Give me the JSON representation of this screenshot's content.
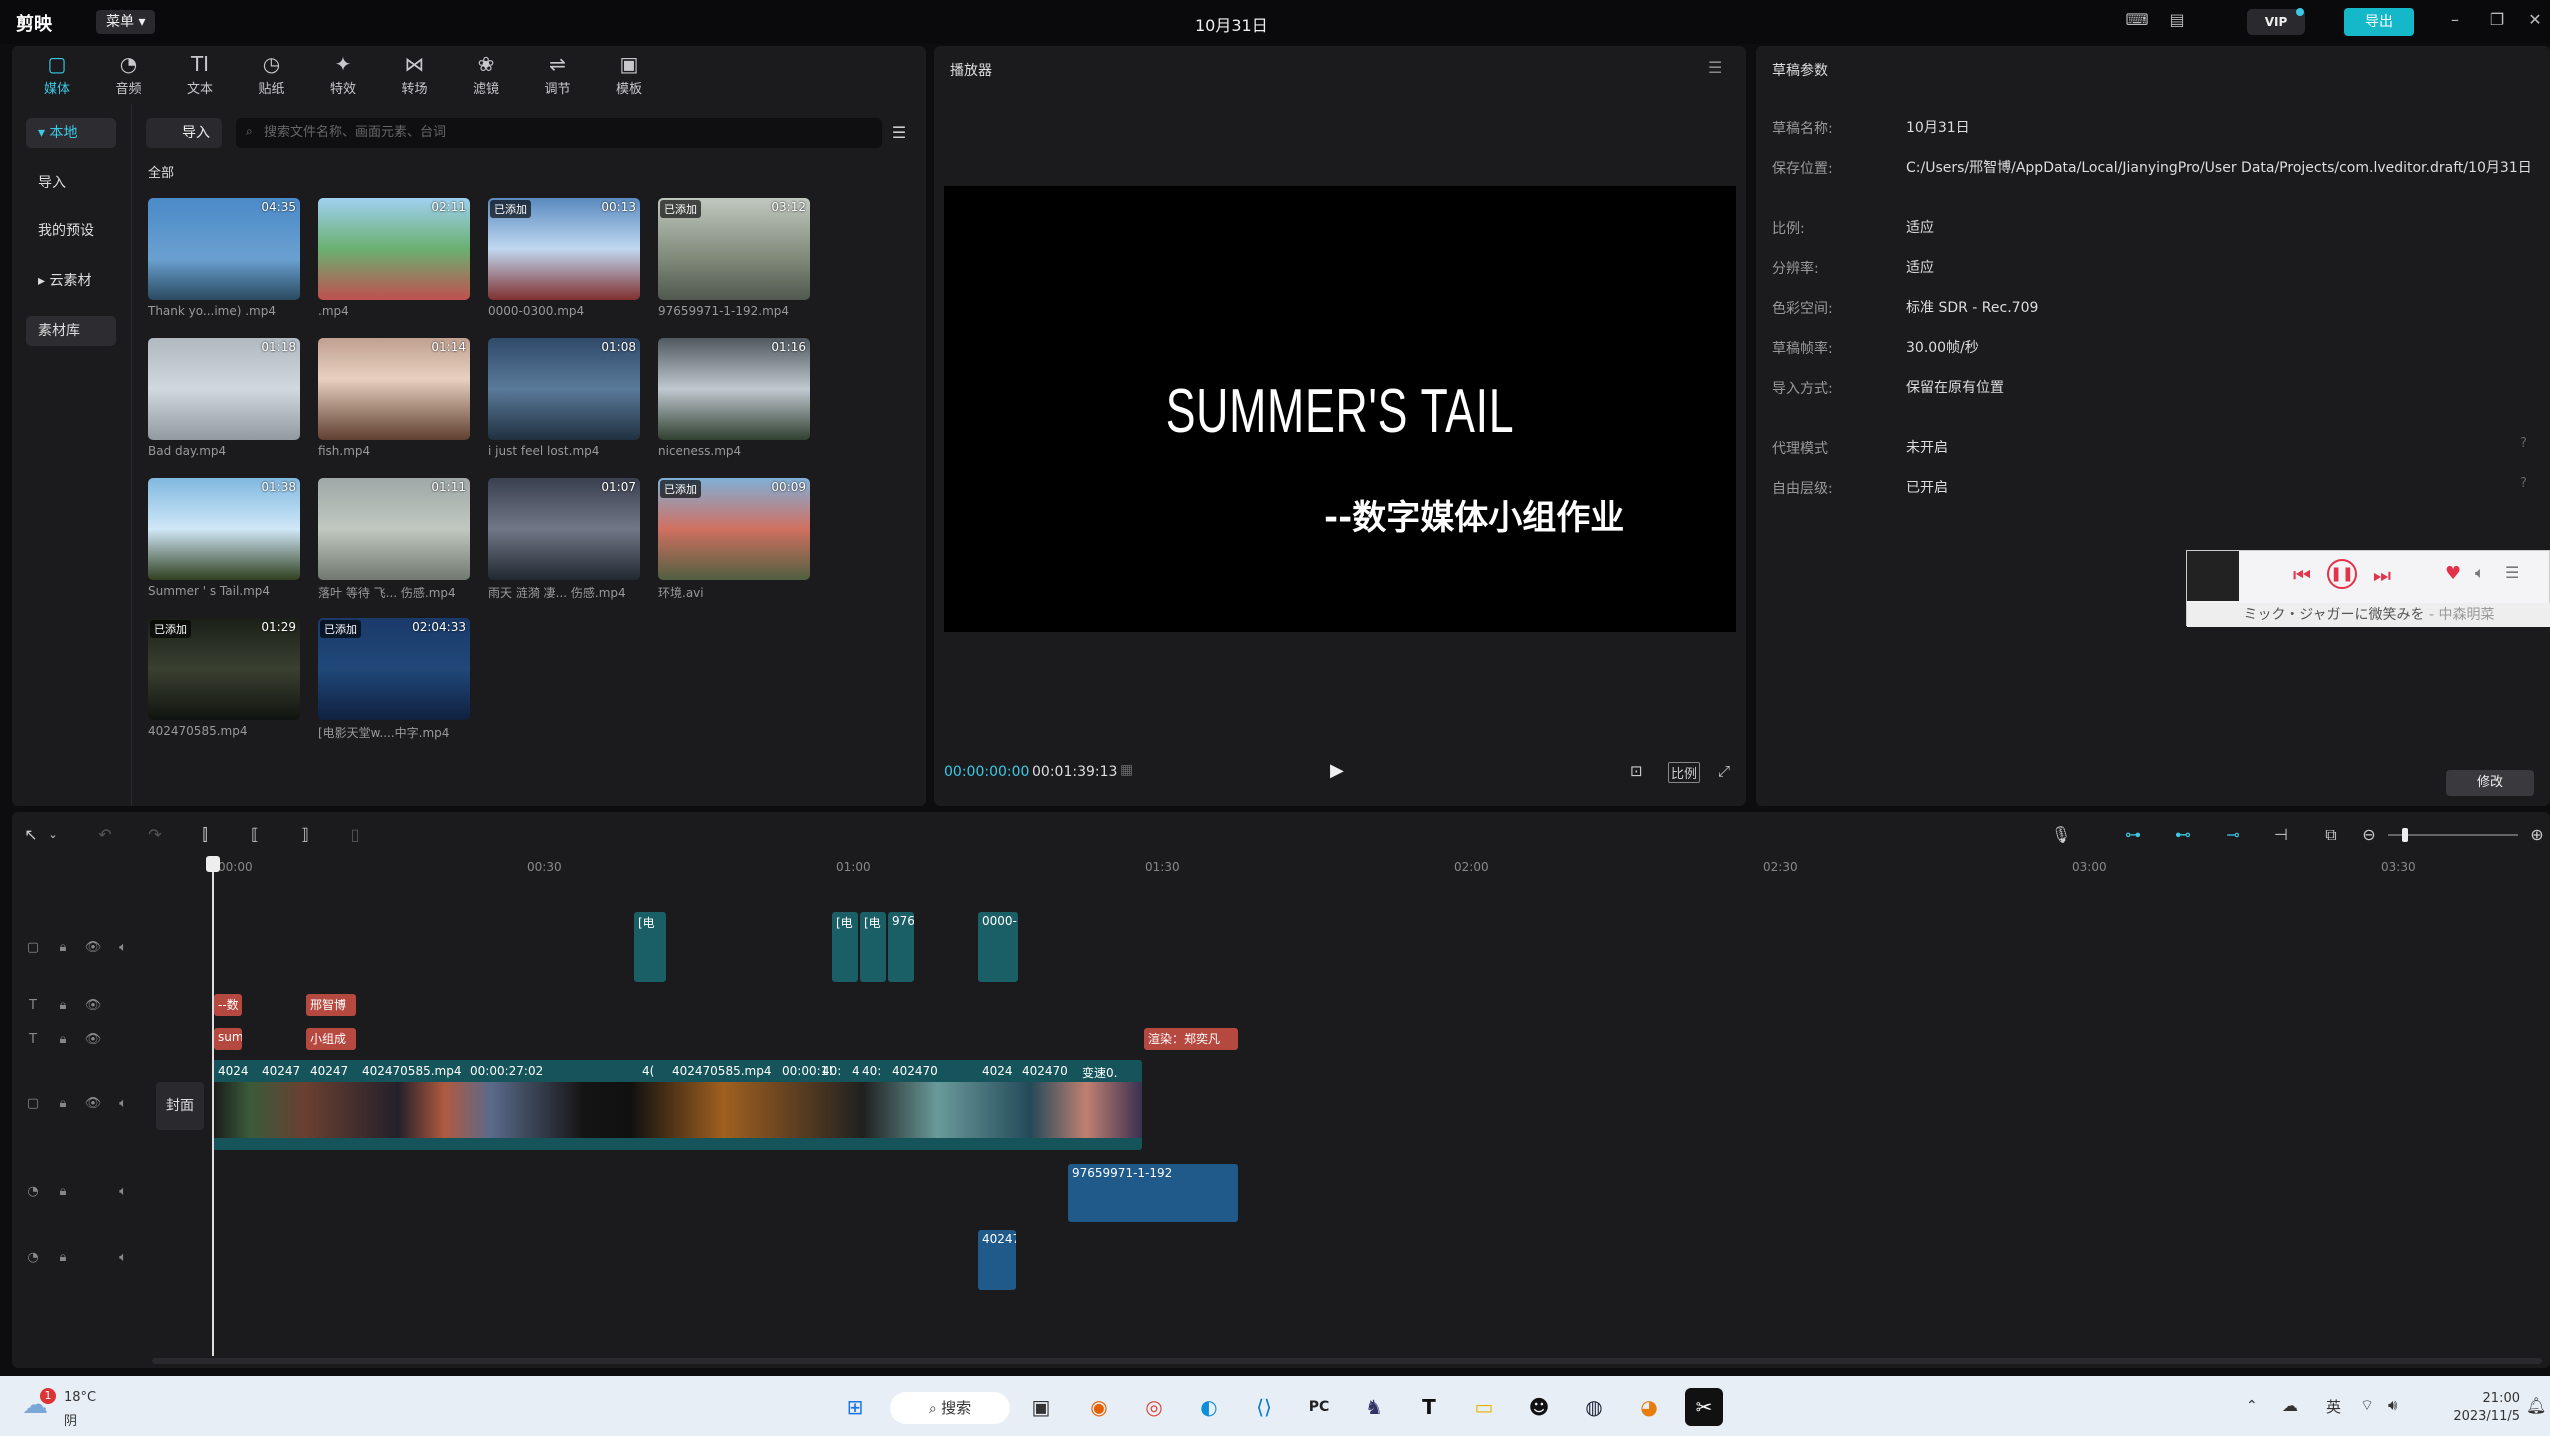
{
  "titlebar": {
    "logo": "剪映",
    "menu": "菜单 ▾",
    "title": "10月31日",
    "vip": "VIP",
    "export": "导出"
  },
  "categories": [
    {
      "label": "媒体",
      "icon": "▢"
    },
    {
      "label": "音频",
      "icon": "◔"
    },
    {
      "label": "文本",
      "icon": "TI"
    },
    {
      "label": "贴纸",
      "icon": "◷"
    },
    {
      "label": "特效",
      "icon": "✦"
    },
    {
      "label": "转场",
      "icon": "⋈"
    },
    {
      "label": "滤镜",
      "icon": "❀"
    },
    {
      "label": "调节",
      "icon": "⇌"
    },
    {
      "label": "模板",
      "icon": "▣"
    }
  ],
  "nav": [
    "▾ 本地",
    "导入",
    "我的预设",
    "▸ 云素材",
    "素材库"
  ],
  "media": {
    "import": "导入",
    "search_placeholder": "搜索文件名称、画面元素、台词",
    "all": "全部",
    "items": [
      {
        "name": "Thank yo...ime) .mp4",
        "dur": "04:35",
        "added": ""
      },
      {
        "name": ".mp4",
        "dur": "02:11",
        "added": ""
      },
      {
        "name": "0000-0300.mp4",
        "dur": "00:13",
        "added": "已添加"
      },
      {
        "name": "97659971-1-192.mp4",
        "dur": "03:12",
        "added": "已添加"
      },
      {
        "name": "Bad day.mp4",
        "dur": "01:18",
        "added": ""
      },
      {
        "name": "fish.mp4",
        "dur": "01:14",
        "added": ""
      },
      {
        "name": "i just feel lost.mp4",
        "dur": "01:08",
        "added": ""
      },
      {
        "name": "niceness.mp4",
        "dur": "01:16",
        "added": ""
      },
      {
        "name": "Summer ' s Tail.mp4",
        "dur": "01:38",
        "added": ""
      },
      {
        "name": "落叶 等待 飞... 伤感.mp4",
        "dur": "01:11",
        "added": ""
      },
      {
        "name": "雨天 涟漪 凄... 伤感.mp4",
        "dur": "01:07",
        "added": ""
      },
      {
        "name": "环境.avi",
        "dur": "00:09",
        "added": "已添加"
      },
      {
        "name": "402470585.mp4",
        "dur": "01:29",
        "added": "已添加"
      },
      {
        "name": "[电影天堂w....中字.mp4",
        "dur": "02:04:33",
        "added": "已添加"
      }
    ]
  },
  "player": {
    "title": "播放器",
    "video_title": "SUMMER'S TAIL",
    "video_subtitle": "--数字媒体小组作业",
    "tc_current": "00:00:00:00",
    "tc_total": "00:01:39:13",
    "ratio": "比例"
  },
  "params": {
    "title": "草稿参数",
    "rows": [
      {
        "label": "草稿名称:",
        "value": "10月31日"
      },
      {
        "label": "保存位置:",
        "value": "C:/Users/邢智博/AppData/Local/JianyingPro/User Data/Projects/com.lveditor.draft/10月31日"
      },
      {
        "label": "比例:",
        "value": "适应"
      },
      {
        "label": "分辨率:",
        "value": "适应"
      },
      {
        "label": "色彩空间:",
        "value": "标准 SDR - Rec.709"
      },
      {
        "label": "草稿帧率:",
        "value": "30.00帧/秒"
      },
      {
        "label": "导入方式:",
        "value": "保留在原有位置"
      },
      {
        "label": "代理模式",
        "value": "未开启"
      },
      {
        "label": "自由层级:",
        "value": "已开启"
      }
    ],
    "modify": "修改"
  },
  "music": {
    "song": "ミック・ジャガーに微笑みを",
    "artist": "- 中森明菜"
  },
  "timeline": {
    "ruler": [
      "00:00",
      "00:30",
      "01:00",
      "01:30",
      "02:00",
      "02:30",
      "03:00",
      "03:30"
    ],
    "cover": "封面",
    "clips": {
      "overlay": [
        "[电",
        "[电",
        "[电",
        "976",
        "0000-"
      ],
      "text1": [
        "--数",
        "邢智博"
      ],
      "text2": [
        "sum",
        "小组成",
        "渲染：郑奕凡"
      ],
      "main": [
        "4024",
        "40247",
        "40247",
        "402470585.mp4",
        "00:00:27:02",
        "4(",
        "402470585.mp4",
        "00:00:1!",
        "40:",
        "4",
        "40:",
        "402470",
        "4024",
        "402470",
        "变速0."
      ],
      "audio1": "97659971-1-192",
      "audio2": "40247"
    }
  },
  "taskbar": {
    "temp": "18°C",
    "weather": "阴",
    "search": "搜索",
    "ime": "英",
    "time": "21:00",
    "date": "2023/11/5",
    "badge": "1"
  }
}
